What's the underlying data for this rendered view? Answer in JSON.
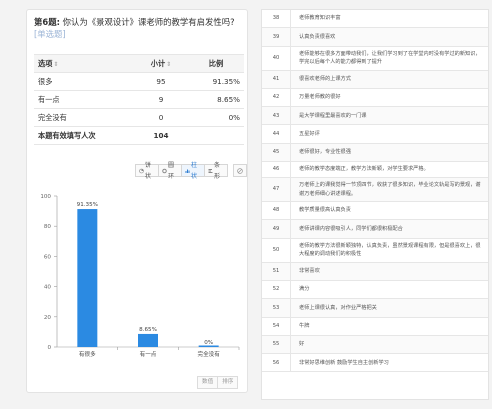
{
  "question": {
    "number": "第6题:",
    "text": "你认为《景观设计》课老师的教学有启发性吗?",
    "type_tag": "[单选题]"
  },
  "table": {
    "headers": {
      "option": "选项",
      "count": "小计",
      "percent": "比例"
    },
    "rows": [
      {
        "option": "很多",
        "count": "95",
        "percent": "91.35%"
      },
      {
        "option": "有一点",
        "count": "9",
        "percent": "8.65%"
      },
      {
        "option": "完全没有",
        "count": "0",
        "percent": "0%"
      }
    ],
    "total": {
      "label": "本题有效填写人次",
      "count": "104"
    }
  },
  "chart_toolbar": {
    "pie": "饼状",
    "ring": "圆环",
    "bar": "柱状",
    "strip": "条形",
    "active": "bar"
  },
  "chart_data": {
    "type": "bar",
    "categories": [
      "有很多",
      "有一点",
      "完全没有"
    ],
    "values": [
      91.35,
      8.65,
      0
    ],
    "value_labels": [
      "91.35%",
      "8.65%",
      "0%"
    ],
    "y_ticks": [
      "100",
      "80",
      "60",
      "40",
      "20",
      "0"
    ],
    "ylim": [
      0,
      100
    ],
    "grid": false,
    "color": "#2b8ae2"
  },
  "bottom_buttons": {
    "data": "数值",
    "sort": "排序"
  },
  "list": [
    {
      "idx": "38",
      "text": "老师教育知识丰富"
    },
    {
      "idx": "39",
      "text": "认真负责很喜欢"
    },
    {
      "idx": "40",
      "text": "老师能够在很多方面带动我们，让我们学习到了在学堂内时没有学过的新知识，学完以后每个人的能力都得到了提升"
    },
    {
      "idx": "41",
      "text": "很喜欢老师的上课方式"
    },
    {
      "idx": "42",
      "text": "万量老师教的很好"
    },
    {
      "idx": "43",
      "text": "是大学课程里最喜欢的一门课"
    },
    {
      "idx": "44",
      "text": "五星好评"
    },
    {
      "idx": "45",
      "text": "老师很好，专业性很强"
    },
    {
      "idx": "46",
      "text": "老师的教学态度端正，教学方法新颖，对学生要求严格。"
    },
    {
      "idx": "47",
      "text": "万老师上的课我觉得一节顶四节，收获了很多知识，毕业论文轨是写的景观，谢谢万老师细心讲述课程。"
    },
    {
      "idx": "48",
      "text": "教学质量很高认真负责"
    },
    {
      "idx": "49",
      "text": "老师讲课内容很吸引人，同学们都很积极配合"
    },
    {
      "idx": "50",
      "text": "老师的教学方法很新颖独特，认真负责，虽然景观课程有限，但是很喜欢上，很大程度的调动我们的积极性"
    },
    {
      "idx": "51",
      "text": "非常喜欢"
    },
    {
      "idx": "52",
      "text": "满分"
    },
    {
      "idx": "53",
      "text": "老师上课很认真，对作业严格把关"
    },
    {
      "idx": "54",
      "text": "牛牌"
    },
    {
      "idx": "55",
      "text": "好"
    },
    {
      "idx": "56",
      "text": "非常好思维创新 鼓励学生自主创新学习"
    }
  ]
}
